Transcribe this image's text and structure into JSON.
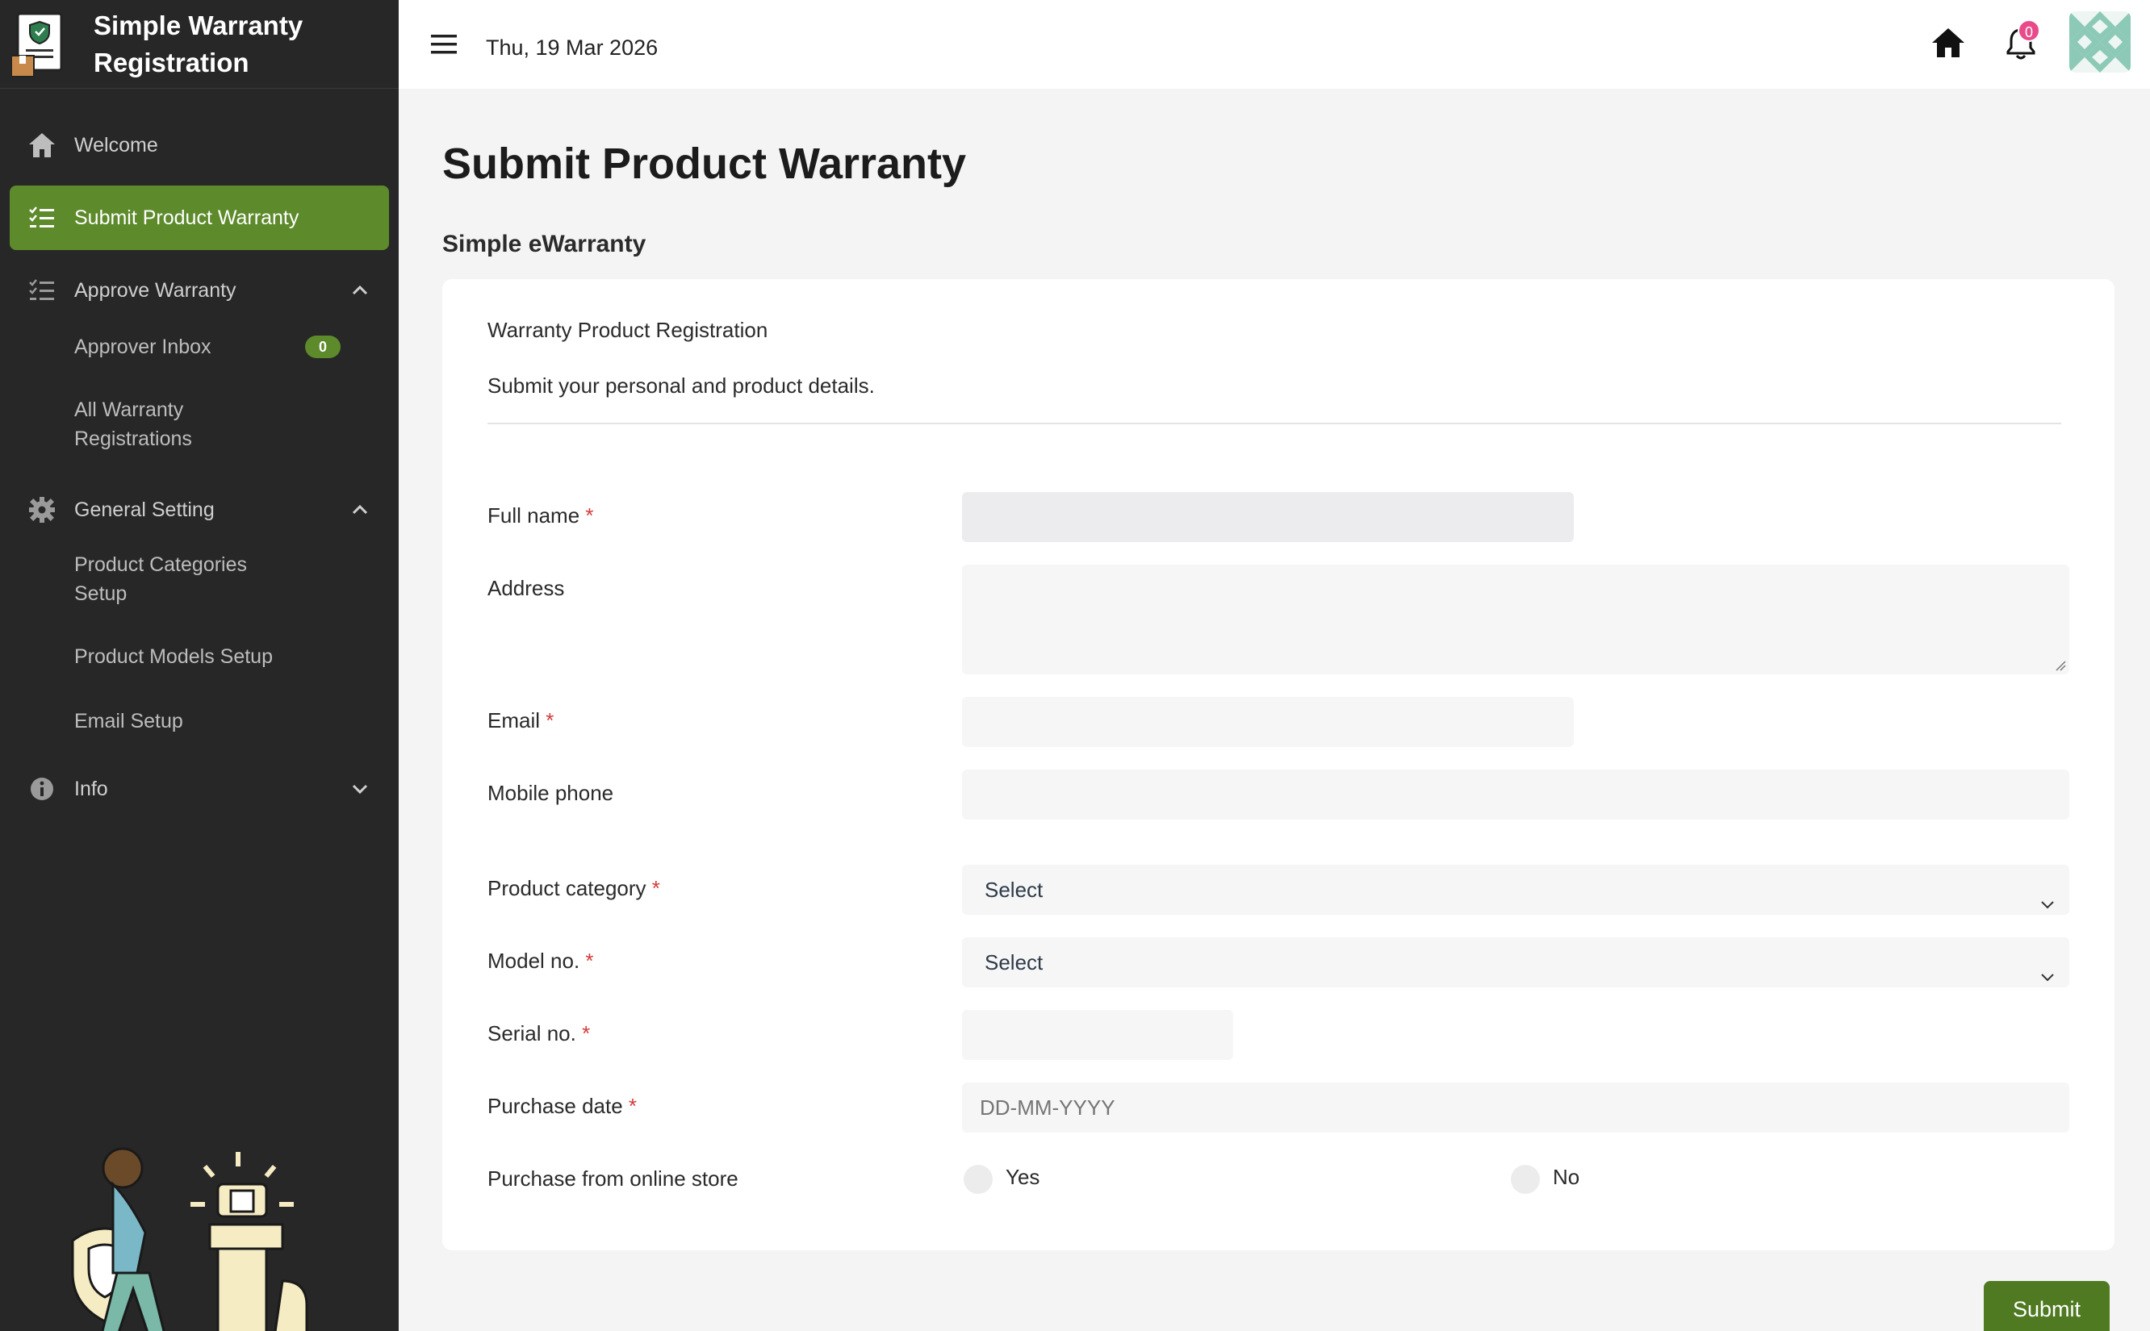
{
  "app": {
    "title": "Simple Warranty Registration"
  },
  "sidebar": {
    "items": [
      {
        "label": "Welcome",
        "icon": "home-icon"
      },
      {
        "label": "Submit Product Warranty",
        "icon": "checklist-icon",
        "active": true
      },
      {
        "label": "Approve Warranty",
        "icon": "checklist-icon",
        "expanded": true,
        "children": [
          {
            "label": "Approver Inbox",
            "badge": "0"
          },
          {
            "label": "All Warranty Registrations"
          }
        ]
      },
      {
        "label": "General Setting",
        "icon": "gear-icon",
        "expanded": true,
        "children": [
          {
            "label": "Product Categories Setup"
          },
          {
            "label": "Product Models Setup"
          },
          {
            "label": "Email Setup"
          }
        ]
      },
      {
        "label": "Info",
        "icon": "info-icon",
        "expanded": false
      }
    ]
  },
  "topbar": {
    "date": "Thu, 19 Mar 2026",
    "notification_count": "0"
  },
  "main": {
    "page_title": "Submit Product Warranty",
    "section_title": "Simple eWarranty",
    "card": {
      "subtitle": "Warranty Product Registration",
      "description": "Submit your personal and product details."
    },
    "form": {
      "full_name_label": "Full name",
      "address_label": "Address",
      "email_label": "Email",
      "mobile_label": "Mobile phone",
      "category_label": "Product category",
      "category_value": "Select",
      "model_label": "Model no.",
      "model_value": "Select",
      "serial_label": "Serial no.",
      "purchase_date_label": "Purchase date",
      "purchase_date_placeholder": "DD-MM-YYYY",
      "online_store_label": "Purchase from online store",
      "yes_label": "Yes",
      "no_label": "No",
      "required_mark": "*"
    },
    "submit_label": "Submit"
  },
  "colors": {
    "sidebar_bg": "#272727",
    "accent": "#5d8a2b",
    "submit": "#4f7a22",
    "required": "#d63a3a",
    "badge_pink": "#e84a8a"
  }
}
